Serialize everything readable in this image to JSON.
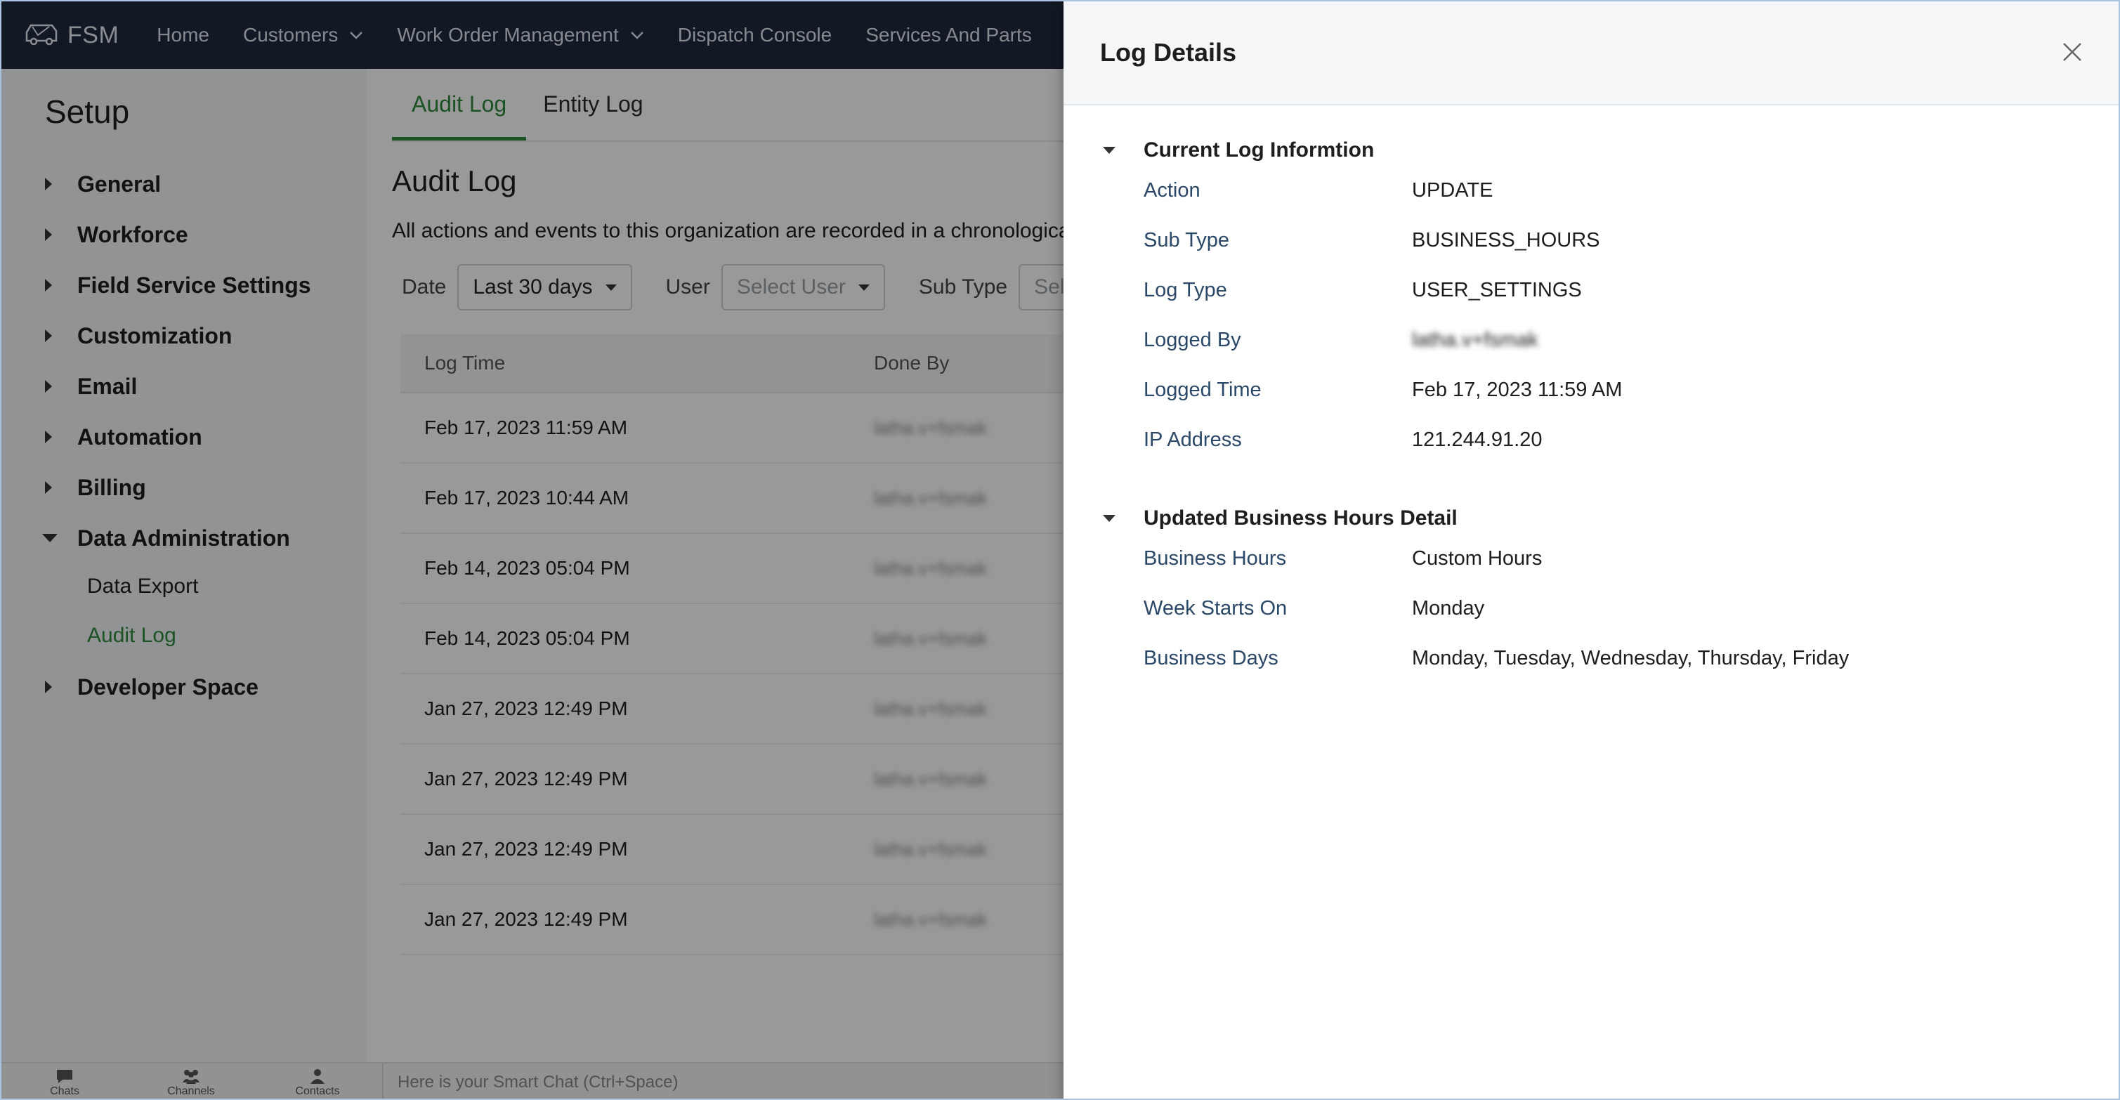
{
  "brand": {
    "name": "FSM",
    "icon": "van-icon"
  },
  "nav": {
    "items": [
      {
        "label": "Home",
        "dropdown": false
      },
      {
        "label": "Customers",
        "dropdown": true
      },
      {
        "label": "Work Order Management",
        "dropdown": true
      },
      {
        "label": "Dispatch Console",
        "dropdown": false
      },
      {
        "label": "Services And Parts",
        "dropdown": false
      }
    ]
  },
  "sidebar": {
    "title": "Setup",
    "items": [
      {
        "label": "General"
      },
      {
        "label": "Workforce"
      },
      {
        "label": "Field Service Settings"
      },
      {
        "label": "Customization"
      },
      {
        "label": "Email"
      },
      {
        "label": "Automation"
      },
      {
        "label": "Billing"
      },
      {
        "label": "Data Administration",
        "expanded": true
      },
      {
        "label": "Developer Space"
      }
    ],
    "sub_items": [
      {
        "label": "Data Export"
      },
      {
        "label": "Audit Log",
        "active": true
      }
    ]
  },
  "main": {
    "tabs": [
      {
        "label": "Audit Log",
        "active": true
      },
      {
        "label": "Entity Log"
      }
    ],
    "heading": "Audit Log",
    "description": "All actions and events to this organization are recorded in a chronological",
    "filters": {
      "date_label": "Date",
      "date_value": "Last 30 days",
      "user_label": "User",
      "user_placeholder": "Select User",
      "subtype_label": "Sub Type",
      "subtype_placeholder": "Selec"
    },
    "table": {
      "headers": [
        "Log Time",
        "Done By"
      ],
      "rows": [
        {
          "time": "Feb 17, 2023 11:59 AM",
          "by": "latha.v+fsmak"
        },
        {
          "time": "Feb 17, 2023 10:44 AM",
          "by": "latha.v+fsmak"
        },
        {
          "time": "Feb 14, 2023 05:04 PM",
          "by": "latha.v+fsmak"
        },
        {
          "time": "Feb 14, 2023 05:04 PM",
          "by": "latha.v+fsmak"
        },
        {
          "time": "Jan 27, 2023 12:49 PM",
          "by": "latha.v+fsmak"
        },
        {
          "time": "Jan 27, 2023 12:49 PM",
          "by": "latha.v+fsmak"
        },
        {
          "time": "Jan 27, 2023 12:49 PM",
          "by": "latha.v+fsmak"
        },
        {
          "time": "Jan 27, 2023 12:49 PM",
          "by": "latha.v+fsmak"
        }
      ]
    }
  },
  "chatbar": {
    "icons": [
      {
        "label": "Chats"
      },
      {
        "label": "Channels"
      },
      {
        "label": "Contacts"
      }
    ],
    "placeholder": "Here is your Smart Chat (Ctrl+Space)"
  },
  "drawer": {
    "title": "Log Details",
    "sections": [
      {
        "title": "Current Log Informtion",
        "rows": [
          {
            "key": "Action",
            "value": "UPDATE"
          },
          {
            "key": "Sub Type",
            "value": "BUSINESS_HOURS"
          },
          {
            "key": "Log Type",
            "value": "USER_SETTINGS"
          },
          {
            "key": "Logged By",
            "value": "latha.v+fsmak",
            "blurred": true
          },
          {
            "key": "Logged Time",
            "value": "Feb 17, 2023 11:59 AM"
          },
          {
            "key": "IP Address",
            "value": "121.244.91.20"
          }
        ]
      },
      {
        "title": "Updated Business Hours Detail",
        "rows": [
          {
            "key": "Business Hours",
            "value": "Custom Hours"
          },
          {
            "key": "Week Starts On",
            "value": "Monday"
          },
          {
            "key": "Business Days",
            "value": "Monday, Tuesday, Wednesday, Thursday, Friday"
          }
        ]
      }
    ]
  },
  "colors": {
    "nav_bg": "#1e2b3c",
    "accent_green": "#2f8a3c",
    "label_blue": "#2b4868"
  }
}
